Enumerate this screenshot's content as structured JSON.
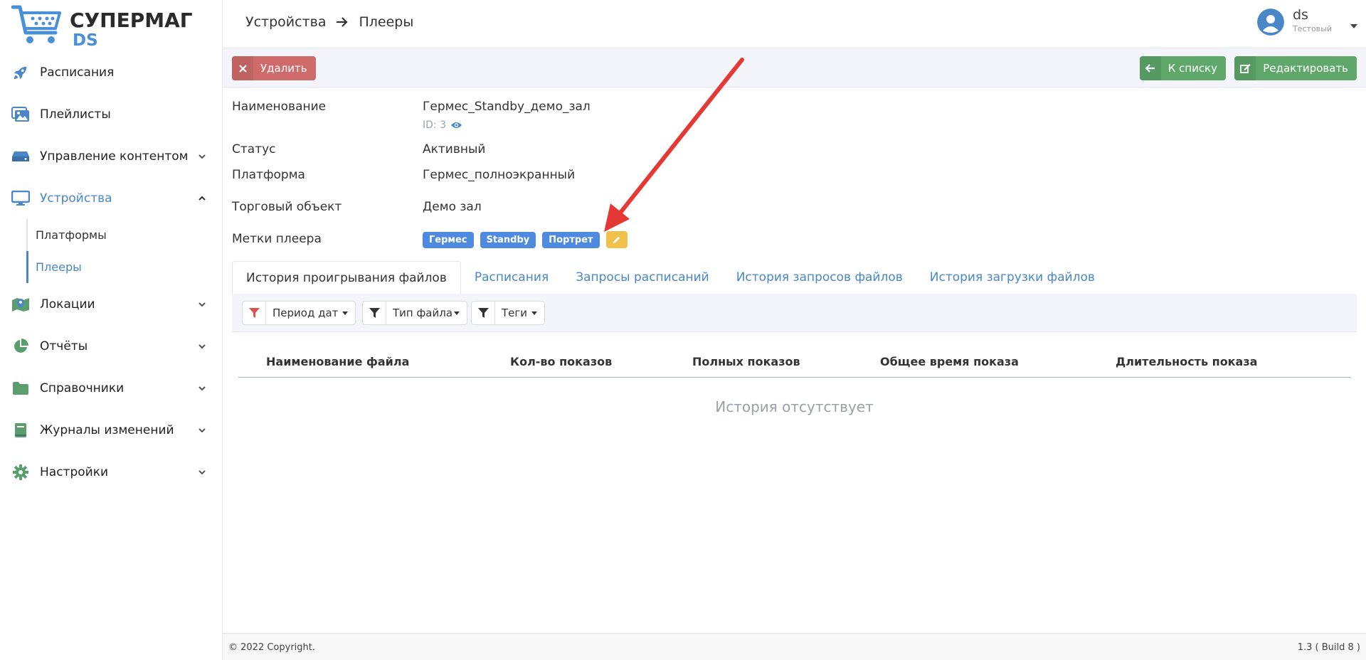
{
  "logo": {
    "line1": "СУПЕРМАГ",
    "line2": "DS"
  },
  "sidebar": {
    "items": [
      {
        "label": "Расписания",
        "icon": "rocket-icon"
      },
      {
        "label": "Плейлисты",
        "icon": "images-icon"
      },
      {
        "label": "Управление контентом",
        "icon": "hdd-icon"
      },
      {
        "label": "Устройства",
        "icon": "monitor-icon"
      },
      {
        "label": "Локации",
        "icon": "map-icon"
      },
      {
        "label": "Отчёты",
        "icon": "pie-chart-icon"
      },
      {
        "label": "Справочники",
        "icon": "folder-icon"
      },
      {
        "label": "Журналы изменений",
        "icon": "book-icon"
      },
      {
        "label": "Настройки",
        "icon": "gear-icon"
      }
    ],
    "subitems": [
      {
        "label": "Платформы"
      },
      {
        "label": "Плееры"
      }
    ]
  },
  "header": {
    "crumb1": "Устройства",
    "crumb2": "Плееры",
    "user_name": "ds",
    "user_role": "Тестовый"
  },
  "toolbar": {
    "delete_label": "Удалить",
    "list_label": "К списку",
    "edit_label": "Редактировать"
  },
  "details": {
    "name_label": "Наименование",
    "name_value": "Гермес_Standby_демо_зал",
    "id_text": "ID: 3",
    "status_label": "Статус",
    "status_value": "Активный",
    "platform_label": "Платформа",
    "platform_value": "Гермес_полноэкранный",
    "store_label": "Торговый объект",
    "store_value": "Демо зал",
    "tags_label": "Метки плеера",
    "tags": [
      "Гермес",
      "Standby",
      "Портрет"
    ]
  },
  "tabs": [
    {
      "label": "История проигрывания файлов"
    },
    {
      "label": "Расписания"
    },
    {
      "label": "Запросы расписаний"
    },
    {
      "label": "История запросов файлов"
    },
    {
      "label": "История загрузки файлов"
    }
  ],
  "filters": {
    "period": "Период дат",
    "file_type": "Тип файла",
    "tags": "Теги"
  },
  "table": {
    "columns": [
      "Наименование файла",
      "Кол-во показов",
      "Полных показов",
      "Общее время показа",
      "Длительность показа"
    ],
    "empty_text": "История отсутствует"
  },
  "footer": {
    "copyright": "© 2022 Copyright.",
    "version": "1.3 ( Build 8 )"
  },
  "colors": {
    "accent": "#4a86c8",
    "delete": "#d06b6b",
    "success": "#5fa86a",
    "tag": "#4e8be0",
    "tag_edit": "#f0c14b",
    "annotation_arrow": "#e53935"
  }
}
